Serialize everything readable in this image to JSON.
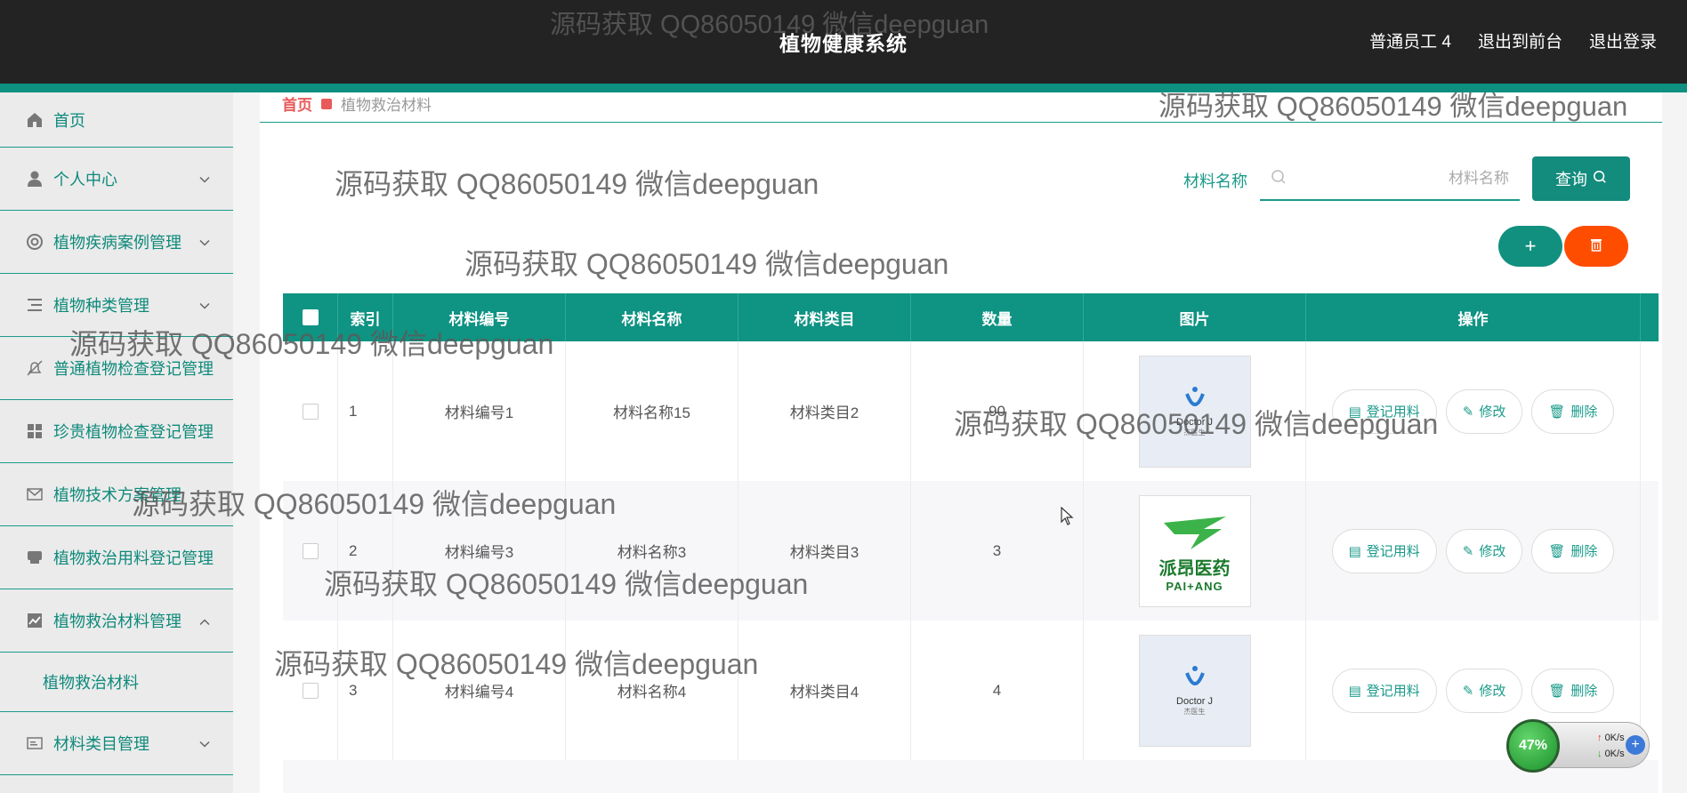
{
  "header": {
    "title": "植物健康系统",
    "user": "普通员工 4",
    "to_front": "退出到前台",
    "logout": "退出登录"
  },
  "sidebar": {
    "items": [
      {
        "label": "首页",
        "icon": "home-icon"
      },
      {
        "label": "个人中心",
        "icon": "user-icon"
      },
      {
        "label": "植物疾病案例管理",
        "icon": "lifebuoy-icon"
      },
      {
        "label": "植物种类管理",
        "icon": "list-icon"
      },
      {
        "label": "普通植物检查登记管理",
        "icon": "bell-off-icon"
      },
      {
        "label": "珍贵植物检查登记管理",
        "icon": "grid-icon"
      },
      {
        "label": "植物技术方案管理",
        "icon": "mail-icon"
      },
      {
        "label": "植物救治用料登记管理",
        "icon": "inbox-icon"
      },
      {
        "label": "植物救治材料管理",
        "icon": "chart-icon"
      },
      {
        "label": "植物救治材料"
      },
      {
        "label": "材料类目管理",
        "icon": "card-icon"
      }
    ]
  },
  "breadcrumb": {
    "home": "首页",
    "current": "植物救治材料"
  },
  "search": {
    "label": "材料名称",
    "placeholder": "材料名称",
    "button": "查询"
  },
  "table": {
    "headers": [
      "索引",
      "材料编号",
      "材料名称",
      "材料类目",
      "数量",
      "图片",
      "操作"
    ],
    "rows": [
      {
        "index": "1",
        "no": "材料编号1",
        "name": "材料名称15",
        "category": "材料类目2",
        "qty": "90",
        "image": "doctor-j-logo"
      },
      {
        "index": "2",
        "no": "材料编号3",
        "name": "材料名称3",
        "category": "材料类目3",
        "qty": "3",
        "image": "paiang-logo"
      },
      {
        "index": "3",
        "no": "材料编号4",
        "name": "材料名称4",
        "category": "材料类目4",
        "qty": "4",
        "image": "doctor-j-logo"
      }
    ],
    "actions": {
      "register": "登记用料",
      "edit": "修改",
      "delete": "删除"
    }
  },
  "logos": {
    "doctor_j": {
      "text": "Doctor J",
      "sub": "杰医生"
    },
    "paiang": {
      "cn": "派昂医药",
      "en": "PAI+ANG"
    }
  },
  "watermark": "源码获取 QQ86050149 微信deepguan",
  "net_widget": {
    "percent": "47%",
    "up": "0K/s",
    "down": "0K/s"
  },
  "colors": {
    "primary": "#0f9383",
    "danger": "#ff4d00",
    "header": "#232323"
  }
}
